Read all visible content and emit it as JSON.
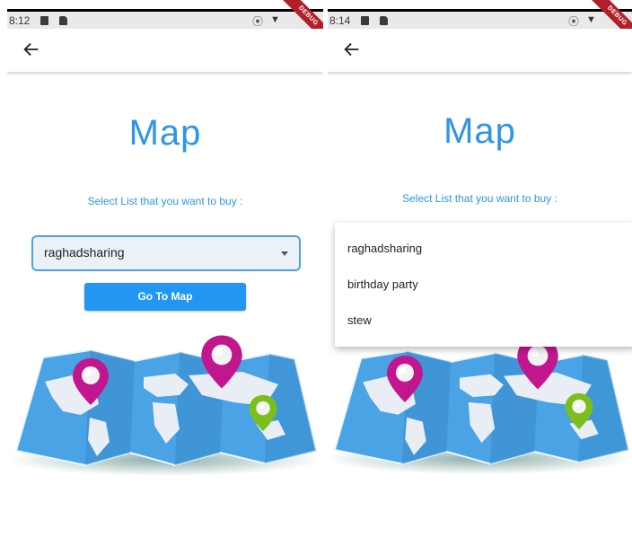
{
  "screens": [
    {
      "status": {
        "time": "8:12",
        "debug_label": "DEBUG"
      },
      "title": "Map",
      "subtitle": "Select List that you want to buy :",
      "dropdown_value": "raghadsharing",
      "button_label": "Go To Map"
    },
    {
      "status": {
        "time": "8:14",
        "debug_label": "DEBUG"
      },
      "title": "Map",
      "subtitle": "Select List that you want to buy :",
      "menu_items": [
        "raghadsharing",
        "birthday party",
        "stew"
      ]
    }
  ],
  "colors": {
    "accent": "#2196f3",
    "title": "#2f95e6",
    "pin_magenta": "#c2168f",
    "pin_green": "#7cbf1a",
    "map_water": "#4aa3e4"
  },
  "icons": {
    "back": "arrow-left-icon",
    "dropdown": "caret-down-icon",
    "pins": [
      "map-pin-magenta-icon",
      "map-pin-magenta-icon",
      "map-pin-green-icon"
    ]
  }
}
